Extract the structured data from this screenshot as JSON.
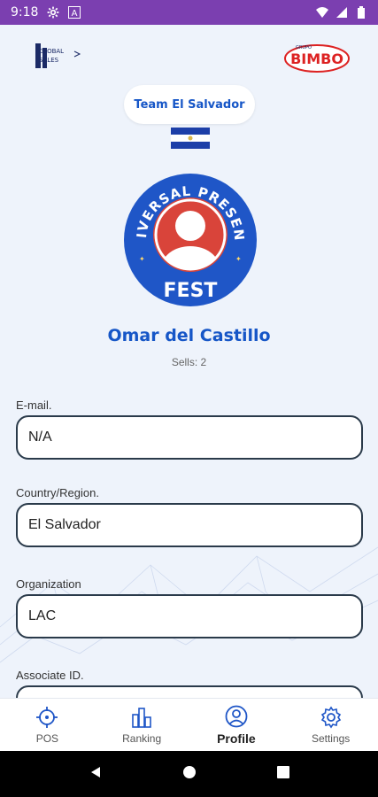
{
  "status_bar": {
    "time": "9:18",
    "bg_color": "#7b3fb0"
  },
  "header": {
    "left_logo_text": "GLOBAL SALES",
    "right_logo_top": "GRUPO",
    "right_logo_text": "BIMBO"
  },
  "team": {
    "label": "Team El Salvador"
  },
  "badge": {
    "top_text": "UNIVERSAL PRESENCE",
    "bottom_text": "FEST"
  },
  "profile": {
    "name": "Omar del Castillo",
    "sells": "Sells: 2"
  },
  "fields": [
    {
      "label": "E-mail.",
      "value": "N/A"
    },
    {
      "label": "Country/Region.",
      "value": "El Salvador"
    },
    {
      "label": "Organization",
      "value": "LAC"
    },
    {
      "label": "Associate ID.",
      "value": ""
    }
  ],
  "nav": {
    "items": [
      {
        "label": "POS",
        "icon": "target-icon"
      },
      {
        "label": "Ranking",
        "icon": "buildings-icon"
      },
      {
        "label": "Profile",
        "icon": "user-circle-icon"
      },
      {
        "label": "Settings",
        "icon": "gear-icon"
      }
    ],
    "active": "Profile"
  },
  "colors": {
    "accent": "#1656c7",
    "background": "#eef3fb",
    "badge_red": "#d9443a"
  }
}
